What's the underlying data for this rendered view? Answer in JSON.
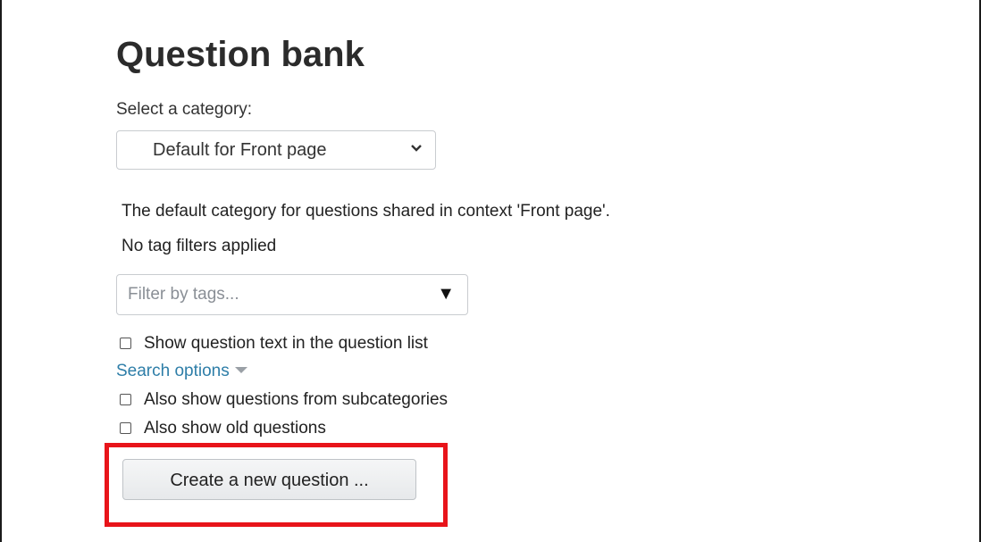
{
  "page": {
    "title": "Question bank",
    "category_label": "Select a category:",
    "category_selected": "Default for Front page",
    "category_description": "The default category for questions shared in context 'Front page'.",
    "tag_status": "No tag filters applied",
    "tag_filter_placeholder": "Filter by tags...",
    "show_question_text_label": "Show question text in the question list",
    "search_options_label": "Search options",
    "subcategories_label": "Also show questions from subcategories",
    "old_questions_label": "Also show old questions",
    "create_button_label": "Create a new question ...",
    "highlight_color": "#e8141a",
    "link_color": "#2e7ea8"
  }
}
